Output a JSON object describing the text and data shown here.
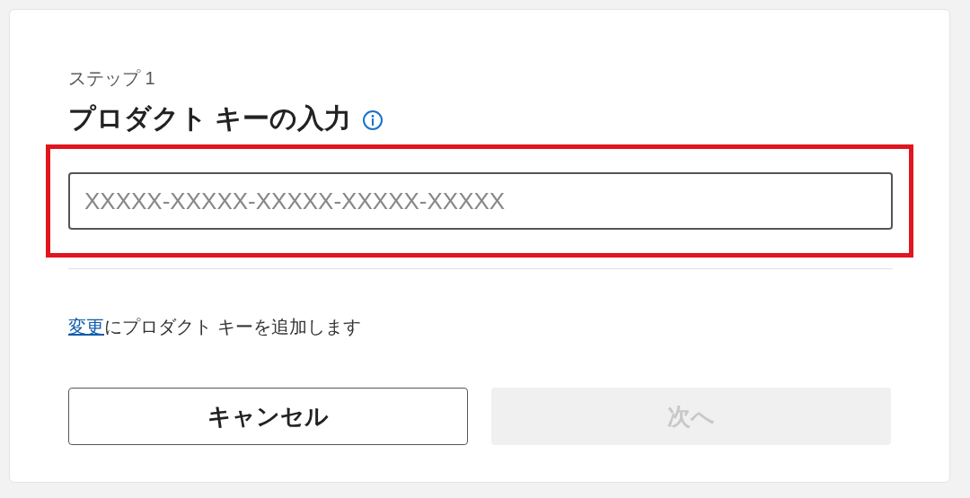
{
  "step_label": "ステップ 1",
  "title": "プロダクト キーの入力",
  "key_field": {
    "placeholder": "XXXXX-XXXXX-XXXXX-XXXXX-XXXXX",
    "highlighted": true
  },
  "note": {
    "link": "変更",
    "text": "にプロダクト キーを追加します"
  },
  "buttons": [
    {
      "label": "キャンセル",
      "disabled": false
    },
    {
      "label": "次へ",
      "disabled": true
    }
  ]
}
